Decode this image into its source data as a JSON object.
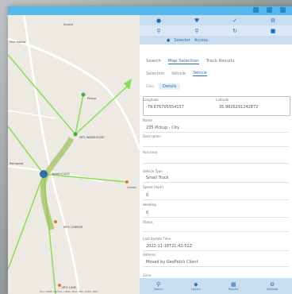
{
  "toolbar": {
    "row1_icons": [
      "person-icon",
      "heart-icon",
      "checkmark-icon",
      "gear-icon"
    ],
    "row2_icons": [
      "search-icon",
      "search-icon",
      "refresh-icon",
      "grid-icon"
    ]
  },
  "selector": {
    "mode1": "Selector",
    "mode2": "Access"
  },
  "tabs_main": [
    "Search",
    "Map Selection",
    "Track Results"
  ],
  "tabs_sub": [
    "Selection",
    "Vehicle",
    "Vehicle"
  ],
  "tabs_detail": [
    "Geo",
    "Details"
  ],
  "form": {
    "longitude_label": "Longitude",
    "longitude_value": "-79.676705554157",
    "latitude_label": "Latitude",
    "latitude_value": "35.9826291242872",
    "name_label": "Name",
    "name_value": "235 Pickup - City",
    "description_label": "Description",
    "accuracy_label": "Accuracy",
    "vehicle_type_label": "Vehicle Type",
    "vehicle_type_value": "Small Truck",
    "speed_label": "Speed (mph)",
    "speed_value": "0",
    "heading_label": "Heading",
    "heading_value": "0",
    "status_label": "Status",
    "last_update_label": "Last Update Time",
    "last_update_value": "2022-11-16T21:42:52Z",
    "address_label": "Address",
    "address_value": "Moved by GeoFetch Client",
    "zone_label": "Zone"
  },
  "bottom_nav": [
    {
      "icon": "search-icon",
      "label": "Search"
    },
    {
      "icon": "layers-icon",
      "label": "Layers"
    },
    {
      "icon": "grid-icon",
      "label": "Results"
    },
    {
      "icon": "settings-icon",
      "label": "Settings"
    }
  ],
  "map": {
    "labels": [
      "Pine Hollow",
      "Sunset",
      "Pickup",
      "MFG WAREHOUSE",
      "WAREHOUSE",
      "Parkwood",
      "MFG CARRIER",
      "MFG LANE",
      "Corner"
    ],
    "footer": "Esri, HERE, Garmin, USGS, NGA, EPA, USDA, NPS"
  },
  "colors": {
    "title": "#55b8ea",
    "toolbar": "#c9ddf0",
    "accent": "#2a6db0",
    "route": "#8adf4e"
  }
}
